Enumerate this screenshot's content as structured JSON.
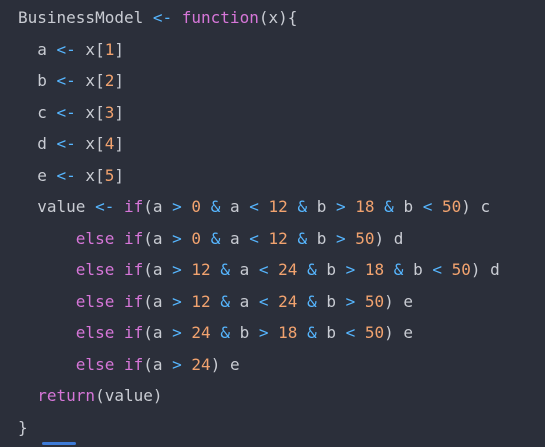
{
  "editor": {
    "colors": {
      "background": "#2b2f3a",
      "plain": "#c9ccd3",
      "operator": "#56b6ff",
      "keyword": "#d676d8",
      "number": "#f2a36f"
    },
    "lines": [
      {
        "indent": 0,
        "tokens": [
          {
            "t": "plain",
            "v": "BusinessModel "
          },
          {
            "t": "op",
            "v": "<-"
          },
          {
            "t": "plain",
            "v": " "
          },
          {
            "t": "kw",
            "v": "function"
          },
          {
            "t": "plain",
            "v": "(x){"
          }
        ]
      },
      {
        "indent": 2,
        "tokens": [
          {
            "t": "plain",
            "v": "a "
          },
          {
            "t": "op",
            "v": "<-"
          },
          {
            "t": "plain",
            "v": " x["
          },
          {
            "t": "num",
            "v": "1"
          },
          {
            "t": "plain",
            "v": "]"
          }
        ]
      },
      {
        "indent": 2,
        "tokens": [
          {
            "t": "plain",
            "v": "b "
          },
          {
            "t": "op",
            "v": "<-"
          },
          {
            "t": "plain",
            "v": " x["
          },
          {
            "t": "num",
            "v": "2"
          },
          {
            "t": "plain",
            "v": "]"
          }
        ]
      },
      {
        "indent": 2,
        "tokens": [
          {
            "t": "plain",
            "v": "c "
          },
          {
            "t": "op",
            "v": "<-"
          },
          {
            "t": "plain",
            "v": " x["
          },
          {
            "t": "num",
            "v": "3"
          },
          {
            "t": "plain",
            "v": "]"
          }
        ]
      },
      {
        "indent": 2,
        "tokens": [
          {
            "t": "plain",
            "v": "d "
          },
          {
            "t": "op",
            "v": "<-"
          },
          {
            "t": "plain",
            "v": " x["
          },
          {
            "t": "num",
            "v": "4"
          },
          {
            "t": "plain",
            "v": "]"
          }
        ]
      },
      {
        "indent": 2,
        "tokens": [
          {
            "t": "plain",
            "v": "e "
          },
          {
            "t": "op",
            "v": "<-"
          },
          {
            "t": "plain",
            "v": " x["
          },
          {
            "t": "num",
            "v": "5"
          },
          {
            "t": "plain",
            "v": "]"
          }
        ]
      },
      {
        "indent": 2,
        "tokens": [
          {
            "t": "plain",
            "v": "value "
          },
          {
            "t": "op",
            "v": "<-"
          },
          {
            "t": "plain",
            "v": " "
          },
          {
            "t": "kw",
            "v": "if"
          },
          {
            "t": "plain",
            "v": "(a "
          },
          {
            "t": "op",
            "v": ">"
          },
          {
            "t": "plain",
            "v": " "
          },
          {
            "t": "num",
            "v": "0"
          },
          {
            "t": "plain",
            "v": " "
          },
          {
            "t": "op",
            "v": "&"
          },
          {
            "t": "plain",
            "v": " a "
          },
          {
            "t": "op",
            "v": "<"
          },
          {
            "t": "plain",
            "v": " "
          },
          {
            "t": "num",
            "v": "12"
          },
          {
            "t": "plain",
            "v": " "
          },
          {
            "t": "op",
            "v": "&"
          },
          {
            "t": "plain",
            "v": " b "
          },
          {
            "t": "op",
            "v": ">"
          },
          {
            "t": "plain",
            "v": " "
          },
          {
            "t": "num",
            "v": "18"
          },
          {
            "t": "plain",
            "v": " "
          },
          {
            "t": "op",
            "v": "&"
          },
          {
            "t": "plain",
            "v": " b "
          },
          {
            "t": "op",
            "v": "<"
          },
          {
            "t": "plain",
            "v": " "
          },
          {
            "t": "num",
            "v": "50"
          },
          {
            "t": "plain",
            "v": ") c"
          }
        ]
      },
      {
        "indent": 6,
        "tokens": [
          {
            "t": "kw",
            "v": "else"
          },
          {
            "t": "plain",
            "v": " "
          },
          {
            "t": "kw",
            "v": "if"
          },
          {
            "t": "plain",
            "v": "(a "
          },
          {
            "t": "op",
            "v": ">"
          },
          {
            "t": "plain",
            "v": " "
          },
          {
            "t": "num",
            "v": "0"
          },
          {
            "t": "plain",
            "v": " "
          },
          {
            "t": "op",
            "v": "&"
          },
          {
            "t": "plain",
            "v": " a "
          },
          {
            "t": "op",
            "v": "<"
          },
          {
            "t": "plain",
            "v": " "
          },
          {
            "t": "num",
            "v": "12"
          },
          {
            "t": "plain",
            "v": " "
          },
          {
            "t": "op",
            "v": "&"
          },
          {
            "t": "plain",
            "v": " b "
          },
          {
            "t": "op",
            "v": ">"
          },
          {
            "t": "plain",
            "v": " "
          },
          {
            "t": "num",
            "v": "50"
          },
          {
            "t": "plain",
            "v": ") d"
          }
        ]
      },
      {
        "indent": 6,
        "tokens": [
          {
            "t": "kw",
            "v": "else"
          },
          {
            "t": "plain",
            "v": " "
          },
          {
            "t": "kw",
            "v": "if"
          },
          {
            "t": "plain",
            "v": "(a "
          },
          {
            "t": "op",
            "v": ">"
          },
          {
            "t": "plain",
            "v": " "
          },
          {
            "t": "num",
            "v": "12"
          },
          {
            "t": "plain",
            "v": " "
          },
          {
            "t": "op",
            "v": "&"
          },
          {
            "t": "plain",
            "v": " a "
          },
          {
            "t": "op",
            "v": "<"
          },
          {
            "t": "plain",
            "v": " "
          },
          {
            "t": "num",
            "v": "24"
          },
          {
            "t": "plain",
            "v": " "
          },
          {
            "t": "op",
            "v": "&"
          },
          {
            "t": "plain",
            "v": " b "
          },
          {
            "t": "op",
            "v": ">"
          },
          {
            "t": "plain",
            "v": " "
          },
          {
            "t": "num",
            "v": "18"
          },
          {
            "t": "plain",
            "v": " "
          },
          {
            "t": "op",
            "v": "&"
          },
          {
            "t": "plain",
            "v": " b "
          },
          {
            "t": "op",
            "v": "<"
          },
          {
            "t": "plain",
            "v": " "
          },
          {
            "t": "num",
            "v": "50"
          },
          {
            "t": "plain",
            "v": ") d"
          }
        ]
      },
      {
        "indent": 6,
        "tokens": [
          {
            "t": "kw",
            "v": "else"
          },
          {
            "t": "plain",
            "v": " "
          },
          {
            "t": "kw",
            "v": "if"
          },
          {
            "t": "plain",
            "v": "(a "
          },
          {
            "t": "op",
            "v": ">"
          },
          {
            "t": "plain",
            "v": " "
          },
          {
            "t": "num",
            "v": "12"
          },
          {
            "t": "plain",
            "v": " "
          },
          {
            "t": "op",
            "v": "&"
          },
          {
            "t": "plain",
            "v": " a "
          },
          {
            "t": "op",
            "v": "<"
          },
          {
            "t": "plain",
            "v": " "
          },
          {
            "t": "num",
            "v": "24"
          },
          {
            "t": "plain",
            "v": " "
          },
          {
            "t": "op",
            "v": "&"
          },
          {
            "t": "plain",
            "v": " b "
          },
          {
            "t": "op",
            "v": ">"
          },
          {
            "t": "plain",
            "v": " "
          },
          {
            "t": "num",
            "v": "50"
          },
          {
            "t": "plain",
            "v": ") e"
          }
        ]
      },
      {
        "indent": 6,
        "tokens": [
          {
            "t": "kw",
            "v": "else"
          },
          {
            "t": "plain",
            "v": " "
          },
          {
            "t": "kw",
            "v": "if"
          },
          {
            "t": "plain",
            "v": "(a "
          },
          {
            "t": "op",
            "v": ">"
          },
          {
            "t": "plain",
            "v": " "
          },
          {
            "t": "num",
            "v": "24"
          },
          {
            "t": "plain",
            "v": " "
          },
          {
            "t": "op",
            "v": "&"
          },
          {
            "t": "plain",
            "v": " b "
          },
          {
            "t": "op",
            "v": ">"
          },
          {
            "t": "plain",
            "v": " "
          },
          {
            "t": "num",
            "v": "18"
          },
          {
            "t": "plain",
            "v": " "
          },
          {
            "t": "op",
            "v": "&"
          },
          {
            "t": "plain",
            "v": " b "
          },
          {
            "t": "op",
            "v": "<"
          },
          {
            "t": "plain",
            "v": " "
          },
          {
            "t": "num",
            "v": "50"
          },
          {
            "t": "plain",
            "v": ") e"
          }
        ]
      },
      {
        "indent": 6,
        "tokens": [
          {
            "t": "kw",
            "v": "else"
          },
          {
            "t": "plain",
            "v": " "
          },
          {
            "t": "kw",
            "v": "if"
          },
          {
            "t": "plain",
            "v": "(a "
          },
          {
            "t": "op",
            "v": ">"
          },
          {
            "t": "plain",
            "v": " "
          },
          {
            "t": "num",
            "v": "24"
          },
          {
            "t": "plain",
            "v": ") e"
          }
        ]
      },
      {
        "indent": 2,
        "tokens": [
          {
            "t": "kw",
            "v": "return"
          },
          {
            "t": "plain",
            "v": "(value)"
          }
        ]
      },
      {
        "indent": 0,
        "tokens": [
          {
            "t": "plain",
            "v": "}"
          }
        ]
      }
    ]
  }
}
